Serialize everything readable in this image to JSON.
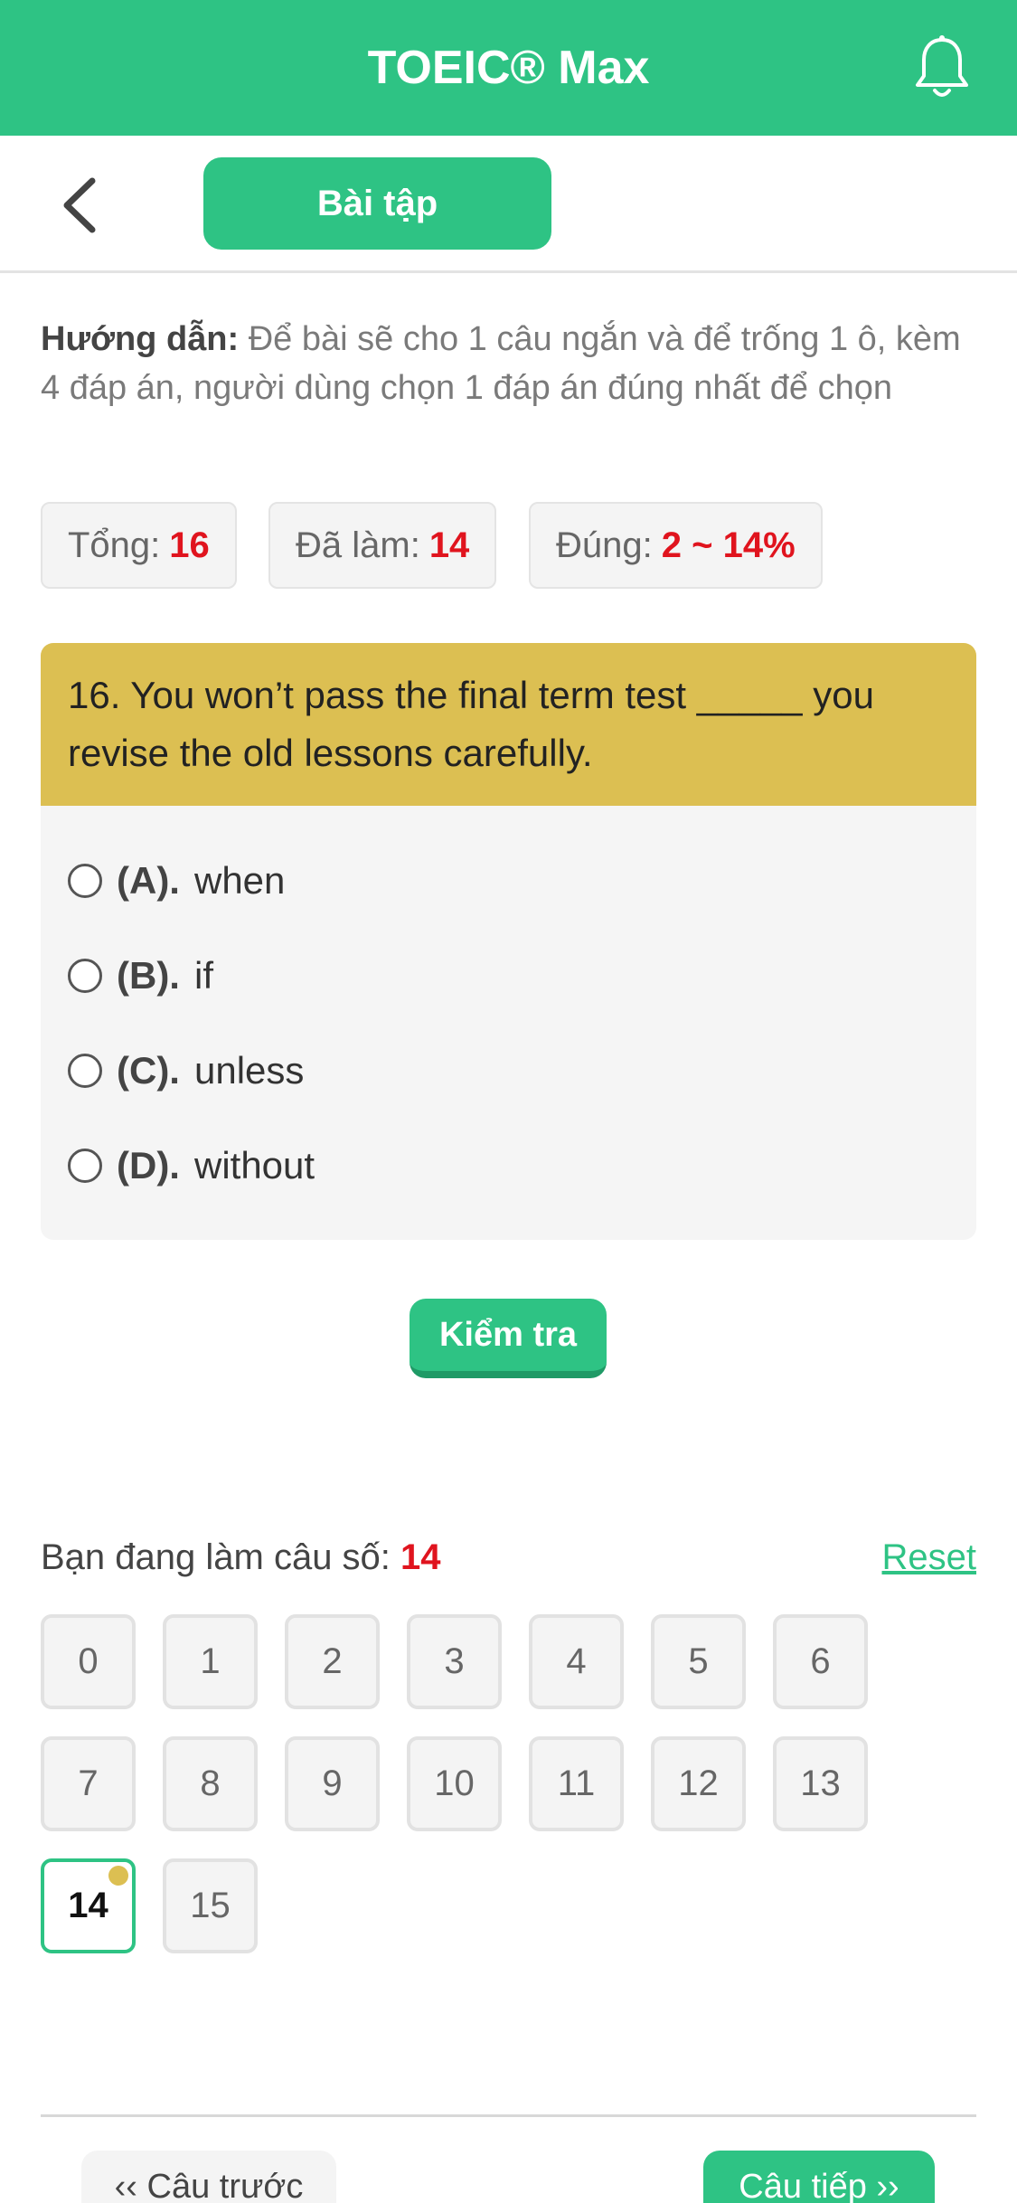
{
  "header": {
    "title": "TOEIC® Max",
    "bell_icon": "bell-icon"
  },
  "subbar": {
    "back_icon": "chevron-left-icon",
    "tab_label": "Bài tập"
  },
  "instruction": {
    "label": "Hướng dẫn:",
    "text": "Để bài sẽ cho 1 câu ngắn và để trống 1 ô, kèm 4 đáp án, người dùng chọn 1 đáp án đúng nhất để chọn"
  },
  "stats": {
    "total_label": "Tổng:",
    "total_value": "16",
    "done_label": "Đã làm:",
    "done_value": "14",
    "correct_label": "Đúng:",
    "correct_value": "2 ~ 14%"
  },
  "question": {
    "text": "16. You won’t pass the final term test _____ you revise the old lessons carefully.",
    "options": [
      {
        "label": "(A).",
        "text": "when"
      },
      {
        "label": "(B).",
        "text": "if"
      },
      {
        "label": "(C).",
        "text": "unless"
      },
      {
        "label": "(D).",
        "text": "without"
      }
    ]
  },
  "check_button": "Kiểm tra",
  "progress": {
    "label": "Bạn đang làm câu số:",
    "current": "14",
    "reset_label": "Reset"
  },
  "numbers": [
    "0",
    "1",
    "2",
    "3",
    "4",
    "5",
    "6",
    "7",
    "8",
    "9",
    "10",
    "11",
    "12",
    "13",
    "14",
    "15"
  ],
  "current_index": 14,
  "colors": {
    "accent": "#2ec384",
    "question_header": "#dcbf52",
    "highlight": "#e0141e"
  },
  "nav": {
    "prev_label": "‹‹ Câu trước",
    "next_label": "Câu tiếp ››"
  }
}
